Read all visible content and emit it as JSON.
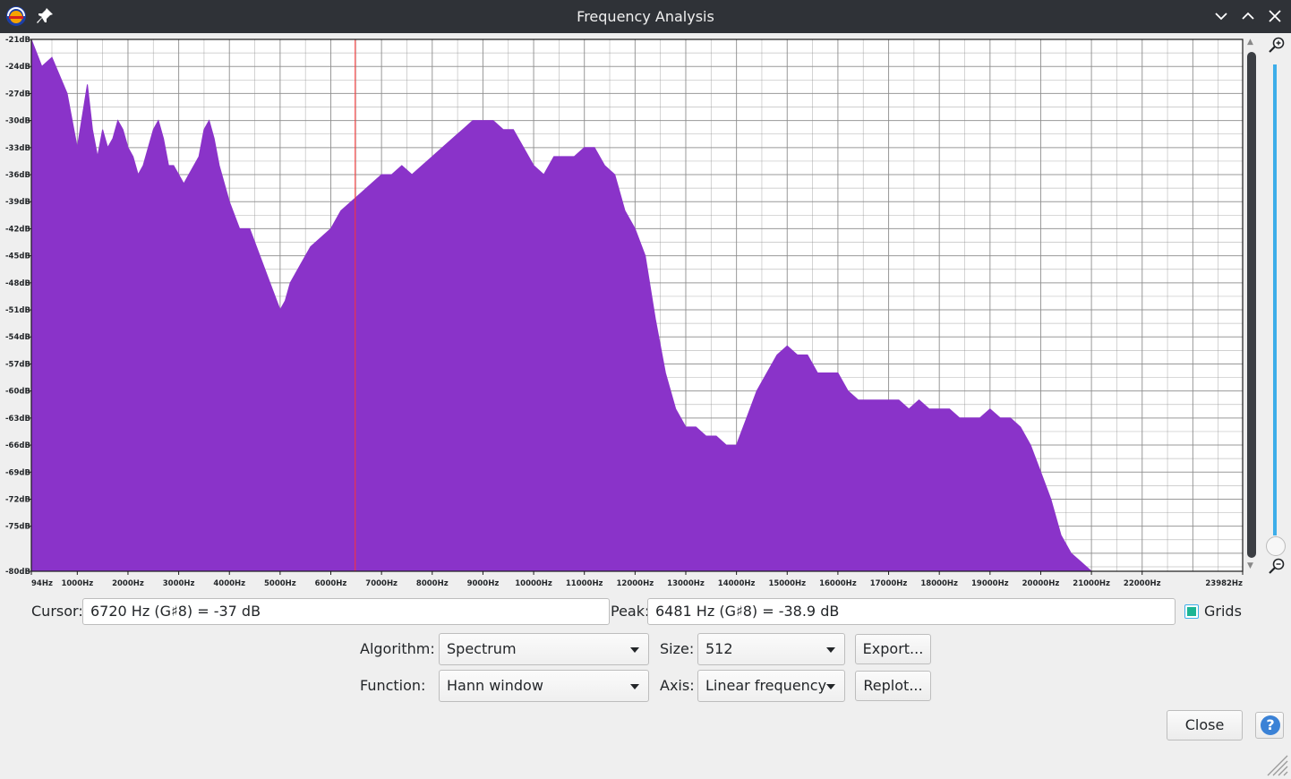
{
  "window": {
    "title": "Frequency Analysis",
    "icons": [
      "audacity-logo-icon",
      "pin-icon",
      "minimize-icon",
      "maximize-icon",
      "close-icon"
    ]
  },
  "colors": {
    "spectrum_fill": "#8a33c9",
    "cursor_line": "#ff3333",
    "grid": "#8e8e8e",
    "zoom_track": "#3daee9",
    "checkbox": "#1cb594"
  },
  "chart_data": {
    "type": "area",
    "xlabel": "",
    "ylabel": "",
    "x_ticks": [
      "94Hz",
      "1000Hz",
      "2000Hz",
      "3000Hz",
      "4000Hz",
      "5000Hz",
      "6000Hz",
      "7000Hz",
      "8000Hz",
      "9000Hz",
      "10000Hz",
      "11000Hz",
      "12000Hz",
      "13000Hz",
      "14000Hz",
      "15000Hz",
      "16000Hz",
      "17000Hz",
      "18000Hz",
      "19000Hz",
      "20000Hz",
      "21000Hz",
      "22000Hz",
      "23982Hz"
    ],
    "y_ticks": [
      "-21dB",
      "-24dB",
      "-27dB",
      "-30dB",
      "-33dB",
      "-36dB",
      "-39dB",
      "-42dB",
      "-45dB",
      "-48dB",
      "-51dB",
      "-54dB",
      "-57dB",
      "-60dB",
      "-63dB",
      "-66dB",
      "-69dB",
      "-72dB",
      "-75dB",
      "-80dB"
    ],
    "xlim": [
      94,
      23982
    ],
    "ylim": [
      -80,
      -21
    ],
    "grid": true,
    "cursor_hz": 6481,
    "series": [
      {
        "x": [
          94,
          300,
          500,
          800,
          1000,
          1200,
          1300,
          1400,
          1500,
          1600,
          1700,
          1800,
          1900,
          2000,
          2100,
          2200,
          2300,
          2400,
          2500,
          2600,
          2700,
          2800,
          2900,
          3000,
          3100,
          3200,
          3300,
          3400,
          3500,
          3600,
          3700,
          3800,
          3900,
          4000,
          4200,
          4400,
          4600,
          4800,
          5000,
          5100,
          5200,
          5400,
          5600,
          5800,
          6000,
          6200,
          6400,
          6600,
          6800,
          7000,
          7200,
          7400,
          7600,
          7800,
          8000,
          8200,
          8400,
          8600,
          8800,
          9000,
          9200,
          9400,
          9600,
          9800,
          10000,
          10200,
          10400,
          10600,
          10800,
          11000,
          11200,
          11400,
          11600,
          11800,
          12000,
          12200,
          12400,
          12600,
          12800,
          13000,
          13200,
          13400,
          13600,
          13800,
          14000,
          14200,
          14400,
          14600,
          14800,
          15000,
          15200,
          15400,
          15600,
          15800,
          16000,
          16200,
          16400,
          16600,
          16800,
          17000,
          17200,
          17400,
          17600,
          17800,
          18000,
          18200,
          18400,
          18600,
          18800,
          19000,
          19200,
          19400,
          19600,
          19800,
          20000,
          20200,
          20400,
          20600,
          20800,
          21000,
          21500,
          22000,
          22500,
          23000,
          23500,
          23982
        ],
        "y": [
          -21,
          -24,
          -23,
          -27,
          -33,
          -26,
          -31,
          -34,
          -31,
          -33,
          -32,
          -30,
          -31,
          -33,
          -34,
          -36,
          -35,
          -33,
          -31,
          -30,
          -32,
          -35,
          -35,
          -36,
          -37,
          -36,
          -35,
          -34,
          -31,
          -30,
          -32,
          -35,
          -37,
          -39,
          -42,
          -42,
          -45,
          -48,
          -51,
          -50,
          -48,
          -46,
          -44,
          -43,
          -42,
          -40,
          -39,
          -38,
          -37,
          -36,
          -36,
          -35,
          -36,
          -35,
          -34,
          -33,
          -32,
          -31,
          -30,
          -30,
          -30,
          -31,
          -31,
          -33,
          -35,
          -36,
          -34,
          -34,
          -34,
          -33,
          -33,
          -35,
          -36,
          -40,
          -42,
          -45,
          -52,
          -58,
          -62,
          -64,
          -64,
          -65,
          -65,
          -66,
          -66,
          -63,
          -60,
          -58,
          -56,
          -55,
          -56,
          -56,
          -58,
          -58,
          -58,
          -60,
          -61,
          -61,
          -61,
          -61,
          -61,
          -62,
          -61,
          -62,
          -62,
          -62,
          -63,
          -63,
          -63,
          -62,
          -63,
          -63,
          -64,
          -66,
          -69,
          -72,
          -76,
          -78,
          -79,
          -80,
          -80,
          -80,
          -80,
          -80,
          -80,
          -80
        ]
      }
    ]
  },
  "cursor": {
    "label": "Cursor:",
    "value": "6720 Hz (G♯8) = -37 dB"
  },
  "peak": {
    "label": "Peak:",
    "value": "6481 Hz (G♯8) = -38.9 dB"
  },
  "grids": {
    "label": "Grids",
    "checked": true
  },
  "algorithm": {
    "label": "Algorithm:",
    "value": "Spectrum"
  },
  "size": {
    "label": "Size:",
    "value": "512"
  },
  "function": {
    "label": "Function:",
    "value": "Hann window"
  },
  "axis": {
    "label": "Axis:",
    "value": "Linear frequency"
  },
  "buttons": {
    "export": "Export...",
    "replot": "Replot...",
    "close": "Close",
    "help": "?"
  }
}
